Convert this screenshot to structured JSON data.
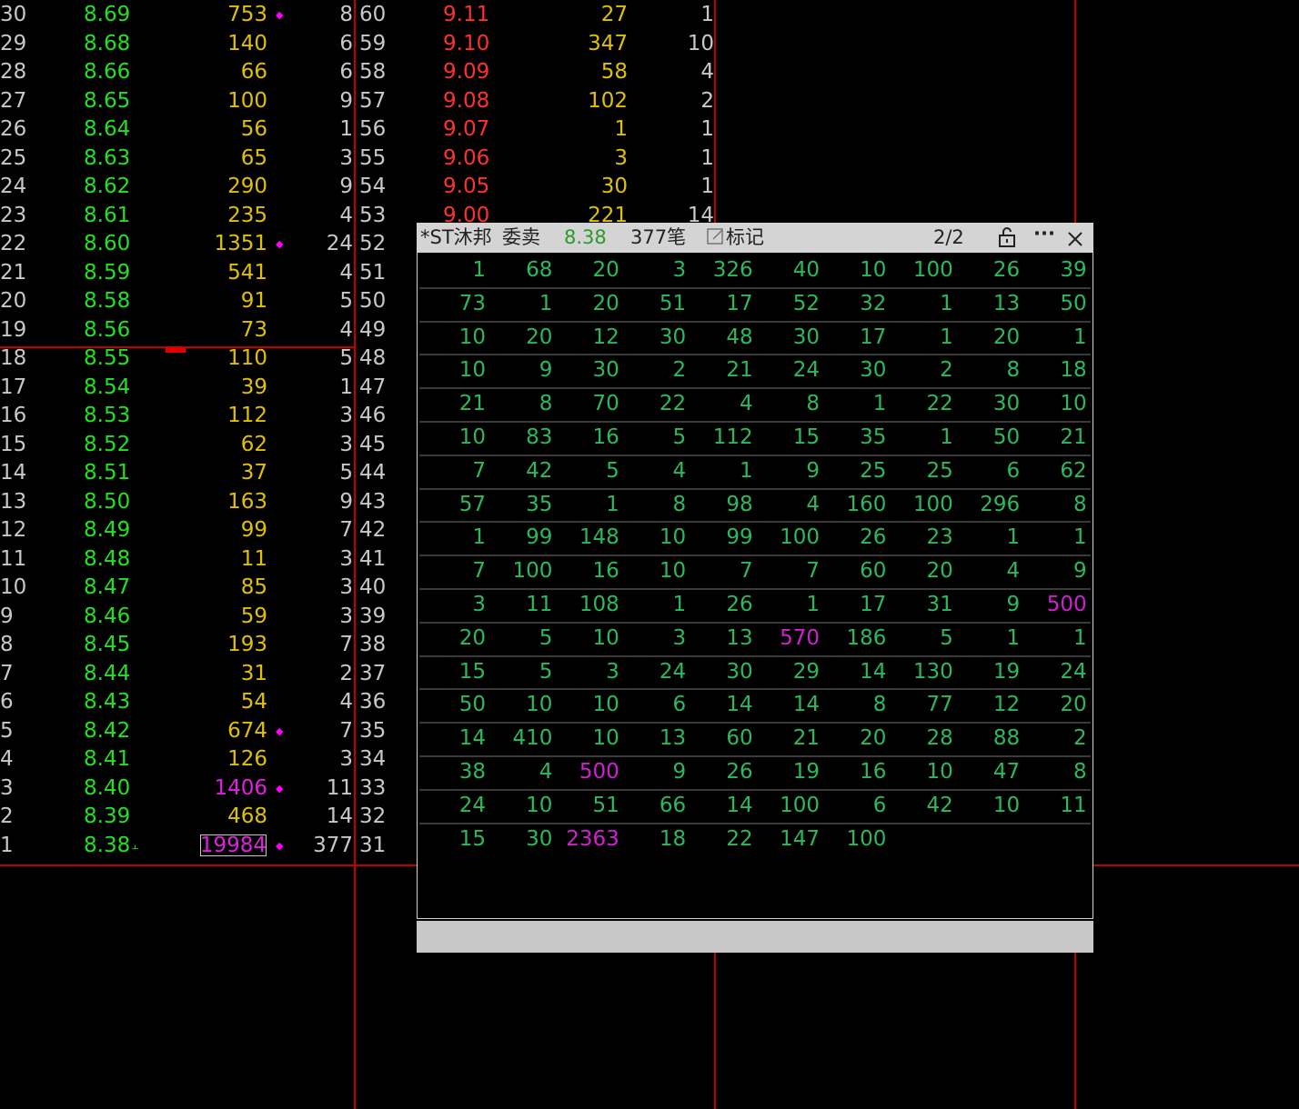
{
  "bid_rows": [
    {
      "level": "30",
      "price": "8.69",
      "volume": "753",
      "mark": "diamond",
      "count": "8"
    },
    {
      "level": "29",
      "price": "8.68",
      "volume": "140",
      "mark": "",
      "count": "6"
    },
    {
      "level": "28",
      "price": "8.66",
      "volume": "66",
      "mark": "",
      "count": "6"
    },
    {
      "level": "27",
      "price": "8.65",
      "volume": "100",
      "mark": "",
      "count": "9"
    },
    {
      "level": "26",
      "price": "8.64",
      "volume": "56",
      "mark": "",
      "count": "1"
    },
    {
      "level": "25",
      "price": "8.63",
      "volume": "65",
      "mark": "",
      "count": "3"
    },
    {
      "level": "24",
      "price": "8.62",
      "volume": "290",
      "mark": "",
      "count": "9"
    },
    {
      "level": "23",
      "price": "8.61",
      "volume": "235",
      "mark": "",
      "count": "4"
    },
    {
      "level": "22",
      "price": "8.60",
      "volume": "1351",
      "mark": "diamond",
      "count": "24"
    },
    {
      "level": "21",
      "price": "8.59",
      "volume": "541",
      "mark": "",
      "count": "4"
    },
    {
      "level": "20",
      "price": "8.58",
      "volume": "91",
      "mark": "",
      "count": "5"
    },
    {
      "level": "19",
      "price": "8.56",
      "volume": "73",
      "mark": "",
      "count": "4"
    },
    {
      "level": "18",
      "price": "8.55",
      "volume": "110",
      "mark": "",
      "count": "5"
    },
    {
      "level": "17",
      "price": "8.54",
      "volume": "39",
      "mark": "",
      "count": "1"
    },
    {
      "level": "16",
      "price": "8.53",
      "volume": "112",
      "mark": "",
      "count": "3"
    },
    {
      "level": "15",
      "price": "8.52",
      "volume": "62",
      "mark": "",
      "count": "3"
    },
    {
      "level": "14",
      "price": "8.51",
      "volume": "37",
      "mark": "",
      "count": "5"
    },
    {
      "level": "13",
      "price": "8.50",
      "volume": "163",
      "mark": "",
      "count": "9"
    },
    {
      "level": "12",
      "price": "8.49",
      "volume": "99",
      "mark": "",
      "count": "7"
    },
    {
      "level": "11",
      "price": "8.48",
      "volume": "11",
      "mark": "",
      "count": "3"
    },
    {
      "level": "10",
      "price": "8.47",
      "volume": "85",
      "mark": "",
      "count": "3"
    },
    {
      "level": "9",
      "price": "8.46",
      "volume": "59",
      "mark": "",
      "count": "3"
    },
    {
      "level": "8",
      "price": "8.45",
      "volume": "193",
      "mark": "",
      "count": "7"
    },
    {
      "level": "7",
      "price": "8.44",
      "volume": "31",
      "mark": "",
      "count": "2"
    },
    {
      "level": "6",
      "price": "8.43",
      "volume": "54",
      "mark": "",
      "count": "4"
    },
    {
      "level": "5",
      "price": "8.42",
      "volume": "674",
      "mark": "diamond",
      "count": "7"
    },
    {
      "level": "4",
      "price": "8.41",
      "volume": "126",
      "mark": "",
      "count": "3"
    },
    {
      "level": "3",
      "price": "8.40",
      "volume": "1406",
      "mark": "diamond",
      "count": "11",
      "highlight": true
    },
    {
      "level": "2",
      "price": "8.39",
      "volume": "468",
      "mark": "",
      "count": "14"
    },
    {
      "level": "1",
      "price": "8.38",
      "volume": "19984",
      "mark": "diamond",
      "count": "377",
      "highlight": true,
      "boxed": true
    }
  ],
  "ask_rows": [
    {
      "level": "60",
      "price": "9.11",
      "volume": "27",
      "count": "1"
    },
    {
      "level": "59",
      "price": "9.10",
      "volume": "347",
      "count": "10"
    },
    {
      "level": "58",
      "price": "9.09",
      "volume": "58",
      "count": "4"
    },
    {
      "level": "57",
      "price": "9.08",
      "volume": "102",
      "count": "2"
    },
    {
      "level": "56",
      "price": "9.07",
      "volume": "1",
      "count": "1"
    },
    {
      "level": "55",
      "price": "9.06",
      "volume": "3",
      "count": "1"
    },
    {
      "level": "54",
      "price": "9.05",
      "volume": "30",
      "count": "1"
    },
    {
      "level": "53",
      "price": "9.00",
      "volume": "221",
      "count": "14"
    },
    {
      "level": "52"
    },
    {
      "level": "51"
    },
    {
      "level": "50"
    },
    {
      "level": "49"
    },
    {
      "level": "48"
    },
    {
      "level": "47"
    },
    {
      "level": "46"
    },
    {
      "level": "45"
    },
    {
      "level": "44"
    },
    {
      "level": "43"
    },
    {
      "level": "42"
    },
    {
      "level": "41"
    },
    {
      "level": "40"
    },
    {
      "level": "39"
    },
    {
      "level": "38"
    },
    {
      "level": "37"
    },
    {
      "level": "36"
    },
    {
      "level": "35"
    },
    {
      "level": "34"
    },
    {
      "level": "33"
    },
    {
      "level": "32"
    },
    {
      "level": "31"
    }
  ],
  "popup": {
    "stock": "*ST沐邦",
    "mode": "委卖",
    "price": "8.38",
    "orders": "377笔",
    "mark_label": "标记",
    "page": "2/2",
    "icons": [
      "lock-icon",
      "more-icon",
      "close-icon"
    ],
    "rows": [
      [
        "1",
        "68",
        "20",
        "3",
        "326",
        "40",
        "10",
        "100",
        "26",
        "39"
      ],
      [
        "73",
        "1",
        "20",
        "51",
        "17",
        "52",
        "32",
        "1",
        "13",
        "50"
      ],
      [
        "10",
        "20",
        "12",
        "30",
        "48",
        "30",
        "17",
        "1",
        "20",
        "1"
      ],
      [
        "10",
        "9",
        "30",
        "2",
        "21",
        "24",
        "30",
        "2",
        "8",
        "18"
      ],
      [
        "21",
        "8",
        "70",
        "22",
        "4",
        "8",
        "1",
        "22",
        "30",
        "10"
      ],
      [
        "10",
        "83",
        "16",
        "5",
        "112",
        "15",
        "35",
        "1",
        "50",
        "21"
      ],
      [
        "7",
        "42",
        "5",
        "4",
        "1",
        "9",
        "25",
        "25",
        "6",
        "62"
      ],
      [
        "57",
        "35",
        "1",
        "8",
        "98",
        "4",
        "160",
        "100",
        "296",
        "8"
      ],
      [
        "1",
        "99",
        "148",
        "10",
        "99",
        "100",
        "26",
        "23",
        "1",
        "1"
      ],
      [
        "7",
        "100",
        "16",
        "10",
        "7",
        "7",
        "60",
        "20",
        "4",
        "9"
      ],
      [
        "3",
        "11",
        "108",
        "1",
        "26",
        "1",
        "17",
        "31",
        "9",
        "500"
      ],
      [
        "20",
        "5",
        "10",
        "3",
        "13",
        "570",
        "186",
        "5",
        "1",
        "1"
      ],
      [
        "15",
        "5",
        "3",
        "24",
        "30",
        "29",
        "14",
        "130",
        "19",
        "24"
      ],
      [
        "50",
        "10",
        "10",
        "6",
        "14",
        "14",
        "8",
        "77",
        "12",
        "20"
      ],
      [
        "14",
        "410",
        "10",
        "13",
        "60",
        "21",
        "20",
        "28",
        "88",
        "2"
      ],
      [
        "38",
        "4",
        "500",
        "9",
        "26",
        "19",
        "16",
        "10",
        "47",
        "8"
      ],
      [
        "24",
        "10",
        "51",
        "66",
        "14",
        "100",
        "6",
        "42",
        "10",
        "11"
      ],
      [
        "15",
        "30",
        "2363",
        "18",
        "22",
        "147",
        "100"
      ]
    ]
  },
  "colors": {
    "bid_price": "#22e022",
    "ask_price": "#ff3030",
    "volume": "#e0c000",
    "large_order": "#e020e0",
    "cell": "#2cb85c",
    "grid": "#c00000"
  }
}
